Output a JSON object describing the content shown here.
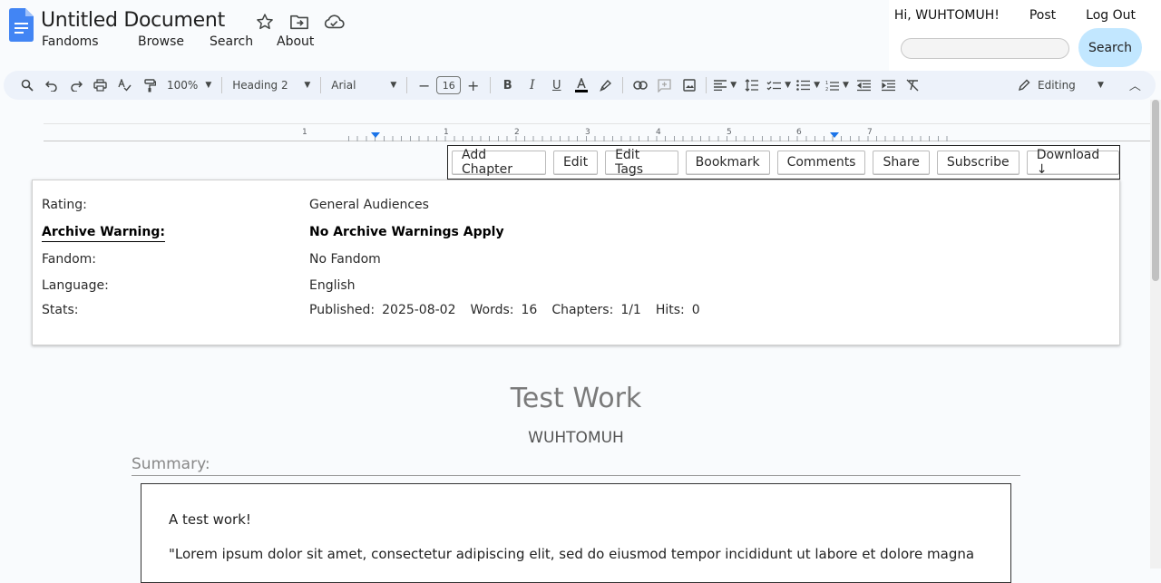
{
  "header": {
    "doc_title": "Untitled Document",
    "nav": [
      "Fandoms",
      "Browse",
      "Search",
      "About"
    ],
    "user": {
      "greeting": "Hi, WUHTOMUH!",
      "post": "Post",
      "logout": "Log Out"
    },
    "search": {
      "placeholder": "",
      "button": "Search"
    }
  },
  "toolbar": {
    "zoom": "100%",
    "style": "Heading 2",
    "font": "Arial",
    "font_size": "16",
    "mode": "Editing"
  },
  "ruler": {
    "numbers": [
      "1",
      "1",
      "2",
      "3",
      "4",
      "5",
      "6",
      "7"
    ]
  },
  "actions": [
    "Add Chapter",
    "Edit",
    "Edit Tags",
    "Bookmark",
    "Comments",
    "Share",
    "Subscribe",
    "Download ↓"
  ],
  "meta": {
    "rating_label": "Rating:",
    "rating_value": "General Audiences",
    "warning_label": "Archive Warning:",
    "warning_value": "No Archive Warnings Apply",
    "fandom_label": "Fandom:",
    "fandom_value": "No Fandom",
    "language_label": "Language:",
    "language_value": "English",
    "stats_label": "Stats:",
    "stats": {
      "published_label": "Published:",
      "published_value": "2025-08-02",
      "words_label": "Words:",
      "words_value": "16",
      "chapters_label": "Chapters:",
      "chapters_value": "1/1",
      "hits_label": "Hits:",
      "hits_value": "0"
    }
  },
  "work": {
    "title": "Test Work",
    "author": "WUHTOMUH",
    "summary_heading": "Summary:",
    "summary_lines": [
      "A test work!",
      "\"Lorem ipsum dolor sit amet, consectetur adipiscing elit, sed do eiusmod tempor incididunt ut labore et dolore magna"
    ]
  },
  "colors": {
    "toolbar_bg": "#edf2fa",
    "search_button_bg": "#c2e7ff",
    "docs_blue": "#4285f4"
  }
}
